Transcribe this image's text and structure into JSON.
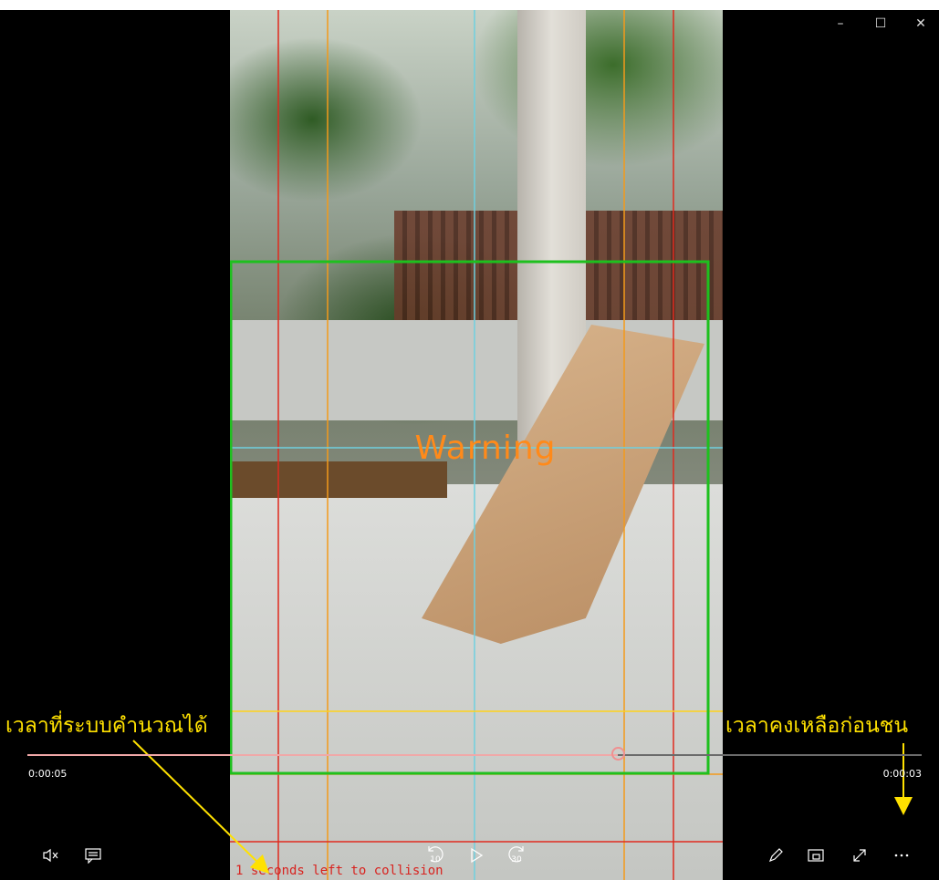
{
  "window": {
    "controls": {
      "minimize": "–",
      "maximize": "☐",
      "close": "✕"
    }
  },
  "video": {
    "overlay_text": "Warning",
    "collision_text": "1  seconds  left  to  collision",
    "colors": {
      "warning": "#ff8a1a",
      "box": "#1ec01e",
      "red_lines": "#e02a1e",
      "orange_lines": "#f39a1a",
      "cyan_lines": "#6fd0e0",
      "yellow_lines": "#ffd21a"
    }
  },
  "annotations": {
    "left_label": "เวลาที่ระบบคำนวณได้",
    "right_label": "เวลาคงเหลือก่อนชน",
    "color": "#ffe100"
  },
  "player": {
    "elapsed": "0:00:05",
    "remaining": "0:00:03",
    "progress_fraction": 0.66,
    "skip_back_label": "10",
    "skip_forward_label": "30",
    "icons": [
      "mute-icon",
      "captions-icon",
      "skip-back-icon",
      "play-icon",
      "skip-forward-icon",
      "pen-icon",
      "mini-view-icon",
      "fullscreen-icon",
      "more-icon"
    ]
  }
}
